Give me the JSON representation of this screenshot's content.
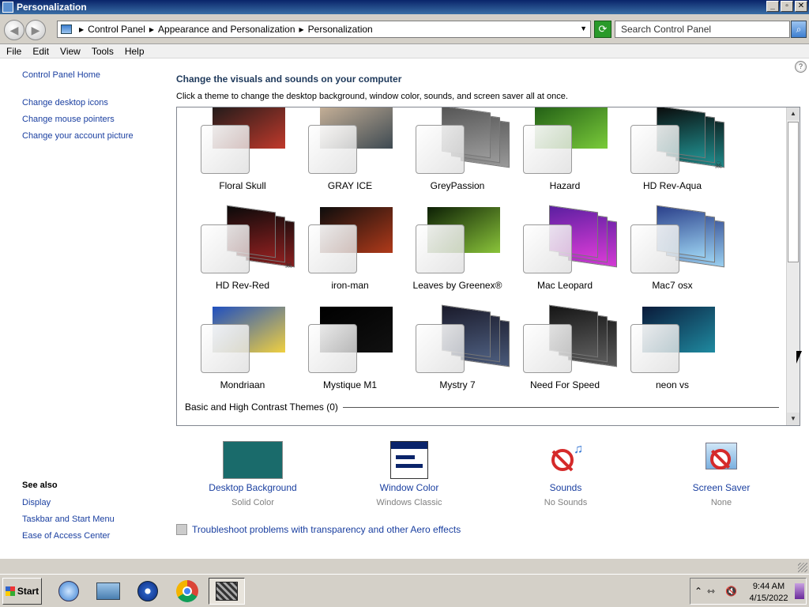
{
  "window": {
    "title": "Personalization"
  },
  "addressbar": {
    "crumbs": [
      "Control Panel",
      "Appearance and Personalization",
      "Personalization"
    ],
    "search_placeholder": "Search Control Panel"
  },
  "menu": {
    "items": [
      "File",
      "Edit",
      "View",
      "Tools",
      "Help"
    ]
  },
  "leftpane": {
    "home": "Control Panel Home",
    "links": [
      "Change desktop icons",
      "Change mouse pointers",
      "Change your account picture"
    ],
    "see_also_heading": "See also",
    "see_also": [
      "Display",
      "Taskbar and Start Menu",
      "Ease of Access Center"
    ]
  },
  "main": {
    "title": "Change the visuals and sounds on your computer",
    "subtitle": "Click a theme to change the desktop background, window color, sounds, and screen saver all at once.",
    "themes": [
      {
        "name": "Floral Skull",
        "style": "single",
        "colors": [
          "#1a1a1a",
          "#c0392b"
        ]
      },
      {
        "name": "GRAY ICE",
        "style": "single",
        "colors": [
          "#cbb49a",
          "#3e4a52"
        ]
      },
      {
        "name": "GreyPassion",
        "style": "stack",
        "colors": [
          "#555555",
          "#999999"
        ]
      },
      {
        "name": "Hazard",
        "style": "single",
        "colors": [
          "#1e5a14",
          "#7acb3a"
        ]
      },
      {
        "name": "HD Rev-Aqua",
        "style": "stack",
        "colors": [
          "#0a0a0a",
          "#1f8a8a"
        ],
        "badge": true
      },
      {
        "name": "HD Rev-Red",
        "style": "stack",
        "colors": [
          "#0a0a0a",
          "#8a1f1f"
        ],
        "badge": true
      },
      {
        "name": "iron-man",
        "style": "single",
        "colors": [
          "#0d0d0d",
          "#b03a1a"
        ]
      },
      {
        "name": "Leaves by Greenex®",
        "style": "single",
        "colors": [
          "#0c1f05",
          "#8ac43a"
        ]
      },
      {
        "name": "Mac Leopard",
        "style": "stack",
        "colors": [
          "#5a1fa0",
          "#d43ad4"
        ]
      },
      {
        "name": "Mac7 osx",
        "style": "stack",
        "colors": [
          "#2a3f8a",
          "#9ad0f0"
        ]
      },
      {
        "name": "Mondriaan",
        "style": "single",
        "colors": [
          "#1f4fc0",
          "#f0d040"
        ]
      },
      {
        "name": "Mystique M1",
        "style": "single",
        "colors": [
          "#000000",
          "#111111"
        ]
      },
      {
        "name": "Mystry 7",
        "style": "stack",
        "colors": [
          "#1a1a2a",
          "#4a5a7a"
        ]
      },
      {
        "name": "Need For Speed",
        "style": "stack",
        "colors": [
          "#151515",
          "#5a5a5a"
        ]
      },
      {
        "name": "neon vs",
        "style": "single",
        "colors": [
          "#0a1a3a",
          "#1f8aa0"
        ]
      }
    ],
    "basic_themes_label": "Basic and High Contrast Themes (0)"
  },
  "options": [
    {
      "name": "Desktop Background",
      "value": "Solid Color",
      "icon": "desktop-background-icon",
      "color": "#1a6b6b"
    },
    {
      "name": "Window Color",
      "value": "Windows Classic",
      "icon": "window-color-icon"
    },
    {
      "name": "Sounds",
      "value": "No Sounds",
      "icon": "sounds-icon"
    },
    {
      "name": "Screen Saver",
      "value": "None",
      "icon": "screen-saver-icon"
    }
  ],
  "troubleshoot": "Troubleshoot problems with transparency and other Aero effects",
  "taskbar": {
    "start": "Start",
    "time": "9:44 AM",
    "date": "4/15/2022"
  }
}
